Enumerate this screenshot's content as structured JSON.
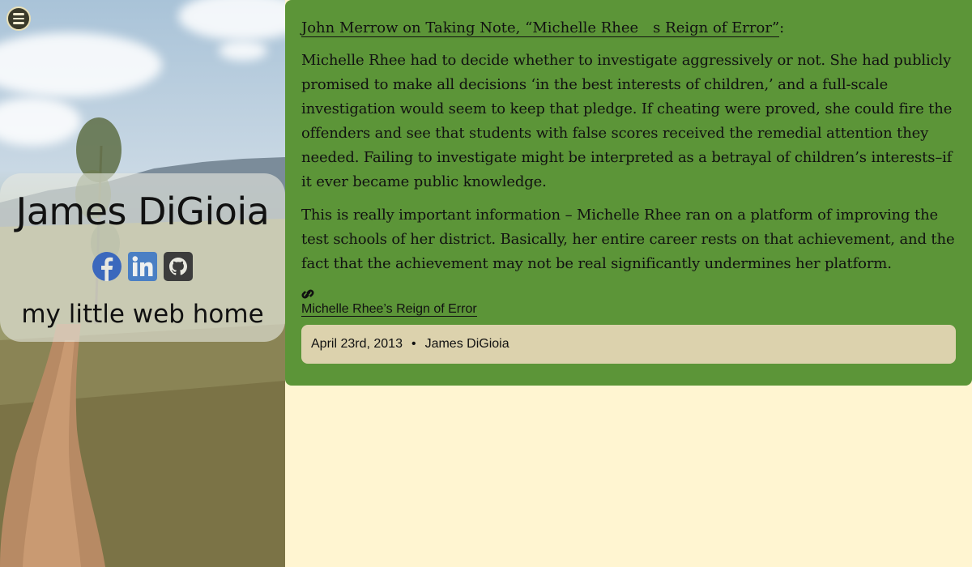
{
  "menu": {
    "icon": "hamburger-menu-icon"
  },
  "sidebar": {
    "site_name": "James DiGioia",
    "tagline": "my little web home",
    "socials": [
      {
        "name": "Facebook",
        "icon": "facebook-icon",
        "color": "#3b68bd"
      },
      {
        "name": "LinkedIn",
        "icon": "linkedin-icon",
        "color": "#4a7fc4"
      },
      {
        "name": "GitHub",
        "icon": "github-icon",
        "color": "#3c3c3c"
      }
    ]
  },
  "post": {
    "intro_link": "John Merrow on Taking Note, “Michelle Rhee s Reign of Error”",
    "intro_suffix": ":",
    "paragraphs": [
      "Michelle Rhee had to decide whether to investigate aggressively or not. She had publicly promised to make all decisions ‘in the best interests of children,’ and a full-scale investigation would seem to keep that pledge. If cheating were proved, she could fire the offenders and see that students with false scores received the remedial attention they needed. Failing to investigate might be interpreted as a betrayal of children’s interests–if it ever became public knowledge.",
      "This is really important information – Michelle Rhee ran on a platform of improving the test schools of her district. Basically, her entire career rests on that achievement, and the fact that the achievement may not be real significantly undermines her platform."
    ],
    "link_icon": "chain-link-icon",
    "source_link": "Michelle Rhee’s Reign of Error",
    "date": "April 23rd, 2013",
    "separator": "•",
    "author": "James DiGioia"
  },
  "colors": {
    "page_bg": "#fff5d1",
    "article_bg": "#5c9538",
    "meta_bg": "#dcd2ad"
  }
}
